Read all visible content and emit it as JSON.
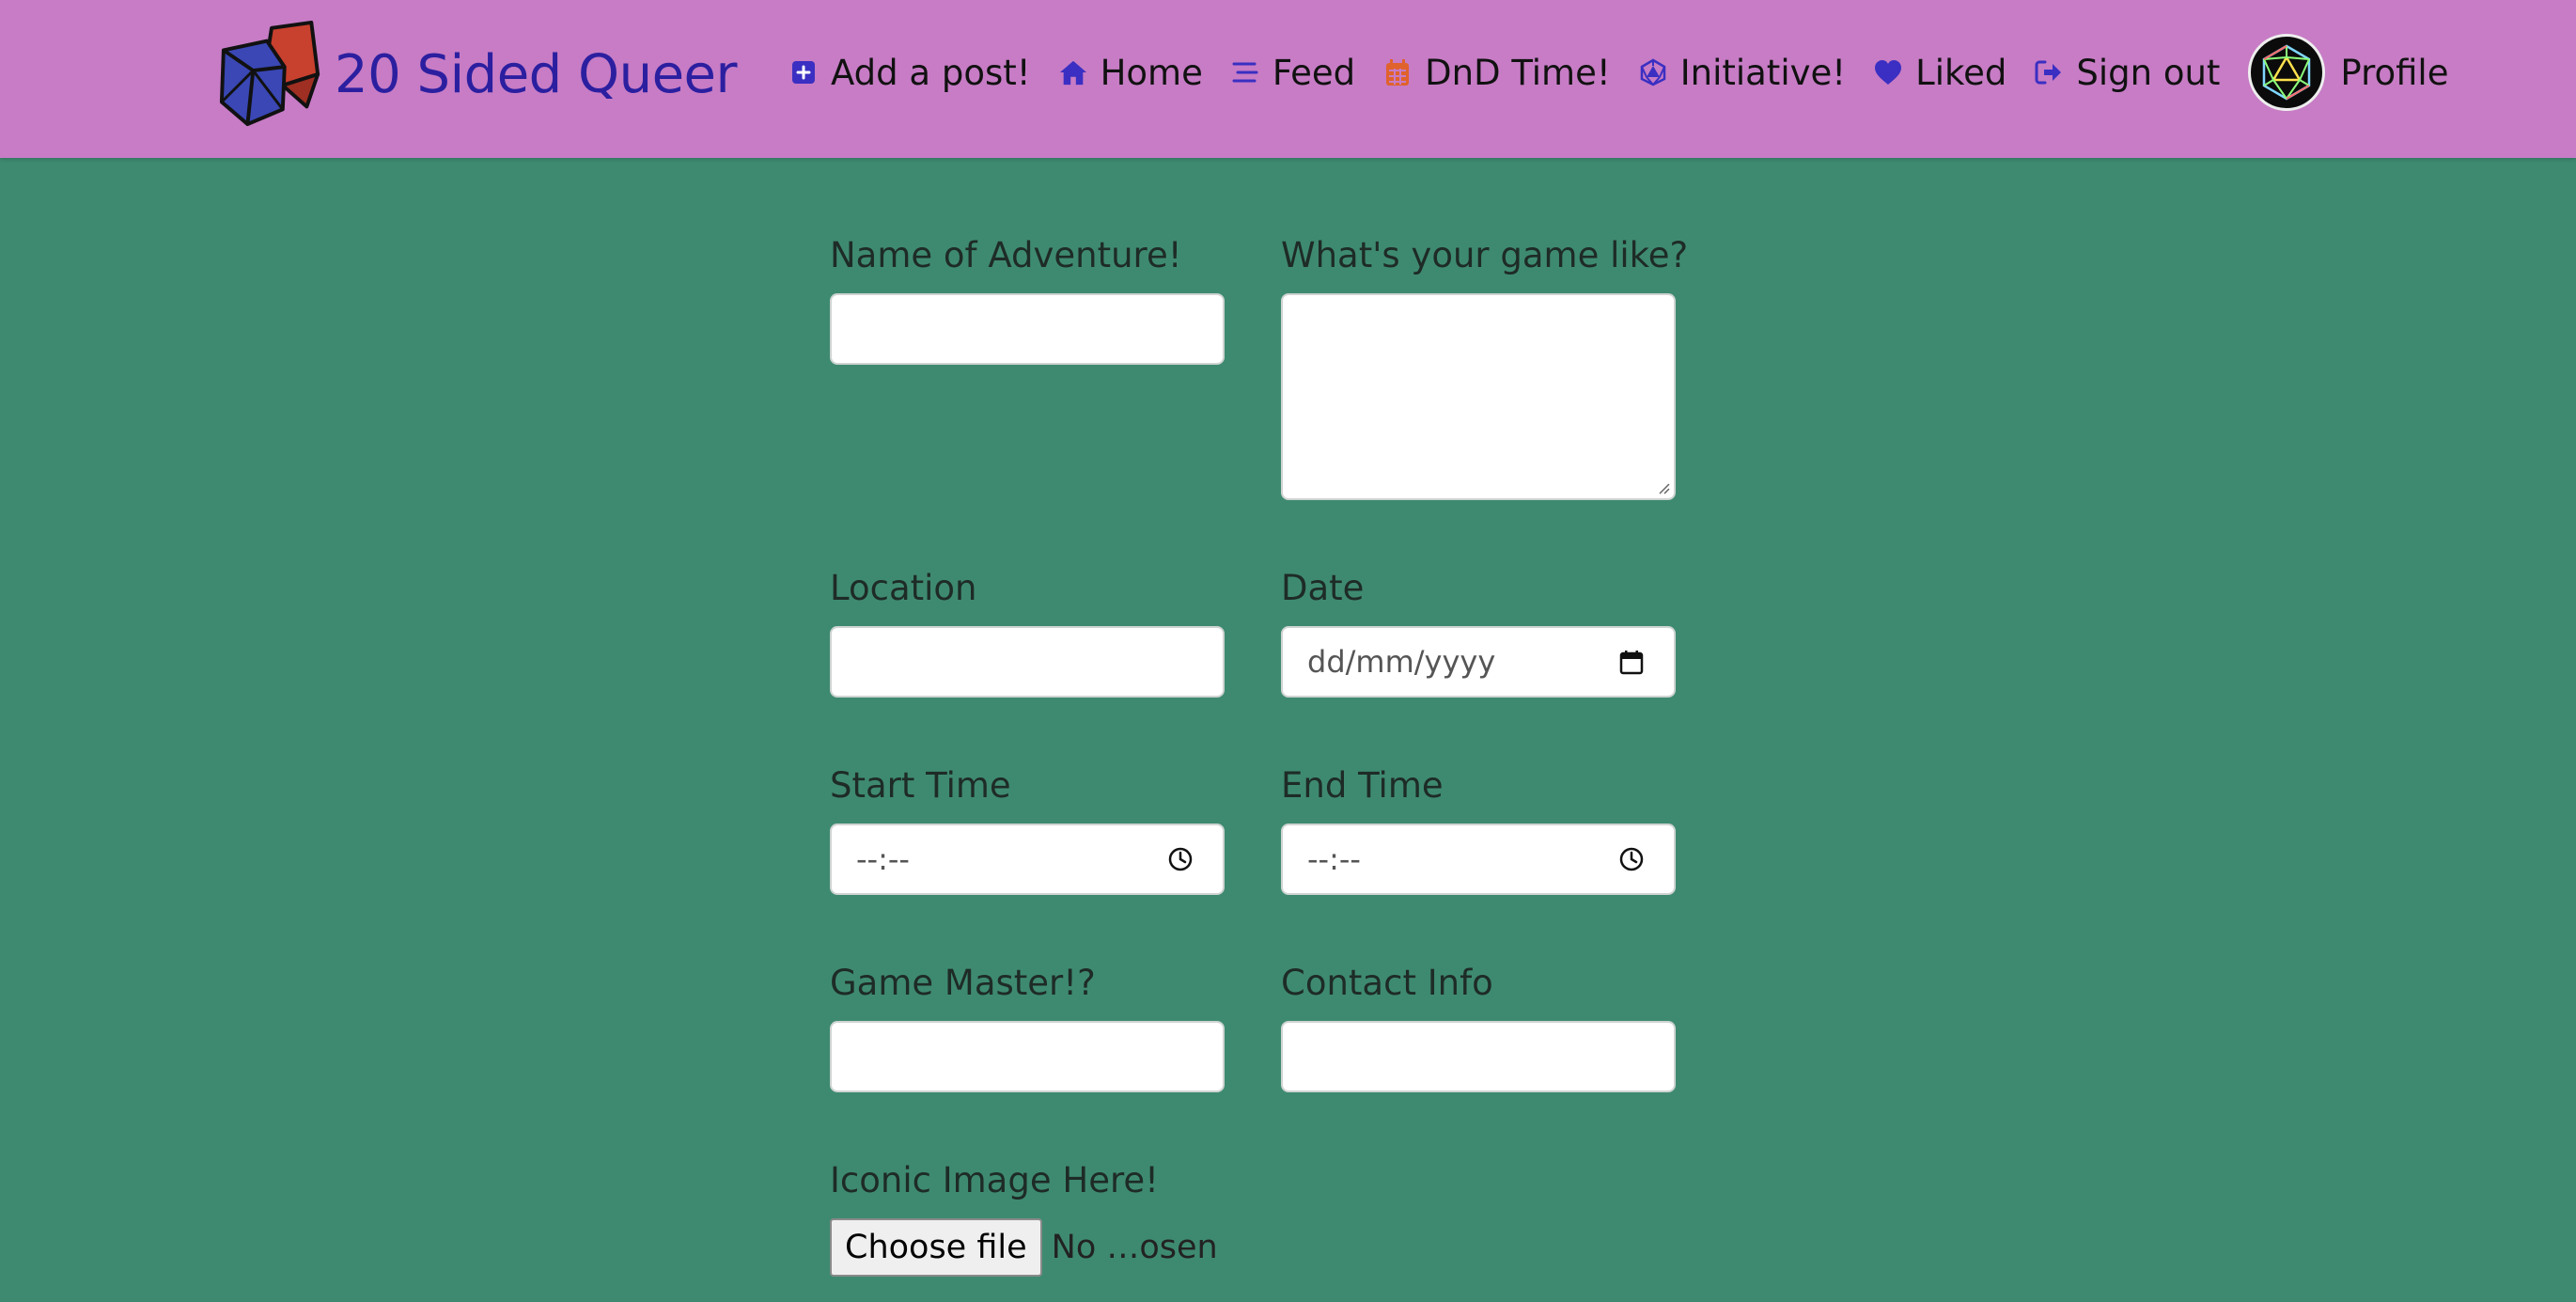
{
  "brand": {
    "title": "20 Sided Queer",
    "logo_icon": "dice-logo-icon"
  },
  "nav": {
    "items": [
      {
        "label": "Add a post!",
        "icon": "plus-square-icon"
      },
      {
        "label": "Home",
        "icon": "house-icon"
      },
      {
        "label": "Feed",
        "icon": "list-icon"
      },
      {
        "label": "DnD Time!",
        "icon": "calendar-icon"
      },
      {
        "label": "Initiative!",
        "icon": "d20-icon"
      },
      {
        "label": "Liked",
        "icon": "heart-icon"
      },
      {
        "label": "Sign out",
        "icon": "sign-out-icon"
      }
    ],
    "profile": {
      "label": "Profile",
      "icon": "avatar-d20-icon"
    }
  },
  "colors": {
    "navbar": "#c77cc5",
    "page_bg": "#3e8a71",
    "brand_text": "#2b1fa0",
    "icon_blue": "#3a2fc2",
    "icon_orange": "#e0622c"
  },
  "form": {
    "name": {
      "label": "Name of Adventure!",
      "value": ""
    },
    "description": {
      "label": "What's your game like?",
      "value": ""
    },
    "location": {
      "label": "Location",
      "value": ""
    },
    "date": {
      "label": "Date",
      "placeholder": "dd/mm/yyyy"
    },
    "start_time": {
      "label": "Start Time",
      "placeholder": "--:--"
    },
    "end_time": {
      "label": "End Time",
      "placeholder": "--:--"
    },
    "game_master": {
      "label": "Game Master!?",
      "value": ""
    },
    "contact": {
      "label": "Contact Info",
      "value": ""
    },
    "image": {
      "label": "Iconic Image Here!",
      "button": "Choose file",
      "status": "No …osen"
    }
  }
}
